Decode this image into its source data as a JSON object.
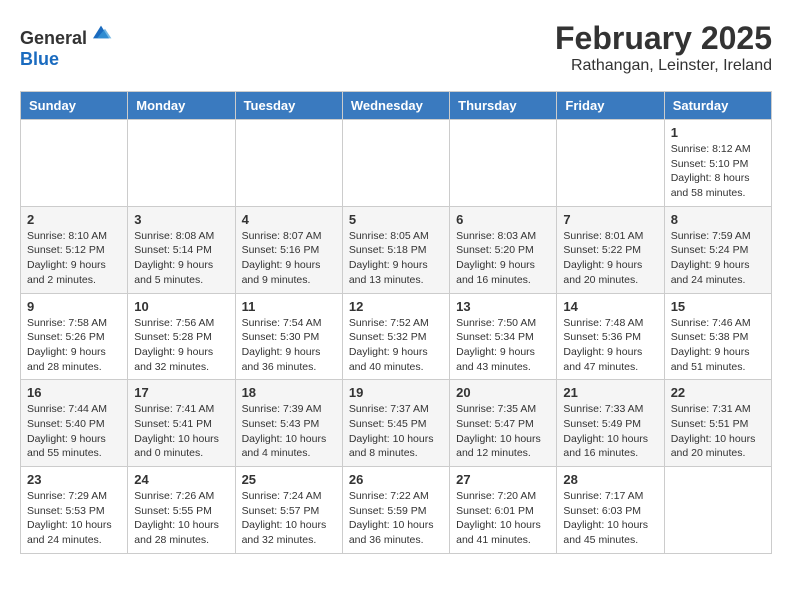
{
  "header": {
    "logo_general": "General",
    "logo_blue": "Blue",
    "month_year": "February 2025",
    "location": "Rathangan, Leinster, Ireland"
  },
  "days_of_week": [
    "Sunday",
    "Monday",
    "Tuesday",
    "Wednesday",
    "Thursday",
    "Friday",
    "Saturday"
  ],
  "weeks": [
    [
      {
        "day": "",
        "info": ""
      },
      {
        "day": "",
        "info": ""
      },
      {
        "day": "",
        "info": ""
      },
      {
        "day": "",
        "info": ""
      },
      {
        "day": "",
        "info": ""
      },
      {
        "day": "",
        "info": ""
      },
      {
        "day": "1",
        "info": "Sunrise: 8:12 AM\nSunset: 5:10 PM\nDaylight: 8 hours and 58 minutes."
      }
    ],
    [
      {
        "day": "2",
        "info": "Sunrise: 8:10 AM\nSunset: 5:12 PM\nDaylight: 9 hours and 2 minutes."
      },
      {
        "day": "3",
        "info": "Sunrise: 8:08 AM\nSunset: 5:14 PM\nDaylight: 9 hours and 5 minutes."
      },
      {
        "day": "4",
        "info": "Sunrise: 8:07 AM\nSunset: 5:16 PM\nDaylight: 9 hours and 9 minutes."
      },
      {
        "day": "5",
        "info": "Sunrise: 8:05 AM\nSunset: 5:18 PM\nDaylight: 9 hours and 13 minutes."
      },
      {
        "day": "6",
        "info": "Sunrise: 8:03 AM\nSunset: 5:20 PM\nDaylight: 9 hours and 16 minutes."
      },
      {
        "day": "7",
        "info": "Sunrise: 8:01 AM\nSunset: 5:22 PM\nDaylight: 9 hours and 20 minutes."
      },
      {
        "day": "8",
        "info": "Sunrise: 7:59 AM\nSunset: 5:24 PM\nDaylight: 9 hours and 24 minutes."
      }
    ],
    [
      {
        "day": "9",
        "info": "Sunrise: 7:58 AM\nSunset: 5:26 PM\nDaylight: 9 hours and 28 minutes."
      },
      {
        "day": "10",
        "info": "Sunrise: 7:56 AM\nSunset: 5:28 PM\nDaylight: 9 hours and 32 minutes."
      },
      {
        "day": "11",
        "info": "Sunrise: 7:54 AM\nSunset: 5:30 PM\nDaylight: 9 hours and 36 minutes."
      },
      {
        "day": "12",
        "info": "Sunrise: 7:52 AM\nSunset: 5:32 PM\nDaylight: 9 hours and 40 minutes."
      },
      {
        "day": "13",
        "info": "Sunrise: 7:50 AM\nSunset: 5:34 PM\nDaylight: 9 hours and 43 minutes."
      },
      {
        "day": "14",
        "info": "Sunrise: 7:48 AM\nSunset: 5:36 PM\nDaylight: 9 hours and 47 minutes."
      },
      {
        "day": "15",
        "info": "Sunrise: 7:46 AM\nSunset: 5:38 PM\nDaylight: 9 hours and 51 minutes."
      }
    ],
    [
      {
        "day": "16",
        "info": "Sunrise: 7:44 AM\nSunset: 5:40 PM\nDaylight: 9 hours and 55 minutes."
      },
      {
        "day": "17",
        "info": "Sunrise: 7:41 AM\nSunset: 5:41 PM\nDaylight: 10 hours and 0 minutes."
      },
      {
        "day": "18",
        "info": "Sunrise: 7:39 AM\nSunset: 5:43 PM\nDaylight: 10 hours and 4 minutes."
      },
      {
        "day": "19",
        "info": "Sunrise: 7:37 AM\nSunset: 5:45 PM\nDaylight: 10 hours and 8 minutes."
      },
      {
        "day": "20",
        "info": "Sunrise: 7:35 AM\nSunset: 5:47 PM\nDaylight: 10 hours and 12 minutes."
      },
      {
        "day": "21",
        "info": "Sunrise: 7:33 AM\nSunset: 5:49 PM\nDaylight: 10 hours and 16 minutes."
      },
      {
        "day": "22",
        "info": "Sunrise: 7:31 AM\nSunset: 5:51 PM\nDaylight: 10 hours and 20 minutes."
      }
    ],
    [
      {
        "day": "23",
        "info": "Sunrise: 7:29 AM\nSunset: 5:53 PM\nDaylight: 10 hours and 24 minutes."
      },
      {
        "day": "24",
        "info": "Sunrise: 7:26 AM\nSunset: 5:55 PM\nDaylight: 10 hours and 28 minutes."
      },
      {
        "day": "25",
        "info": "Sunrise: 7:24 AM\nSunset: 5:57 PM\nDaylight: 10 hours and 32 minutes."
      },
      {
        "day": "26",
        "info": "Sunrise: 7:22 AM\nSunset: 5:59 PM\nDaylight: 10 hours and 36 minutes."
      },
      {
        "day": "27",
        "info": "Sunrise: 7:20 AM\nSunset: 6:01 PM\nDaylight: 10 hours and 41 minutes."
      },
      {
        "day": "28",
        "info": "Sunrise: 7:17 AM\nSunset: 6:03 PM\nDaylight: 10 hours and 45 minutes."
      },
      {
        "day": "",
        "info": ""
      }
    ]
  ]
}
